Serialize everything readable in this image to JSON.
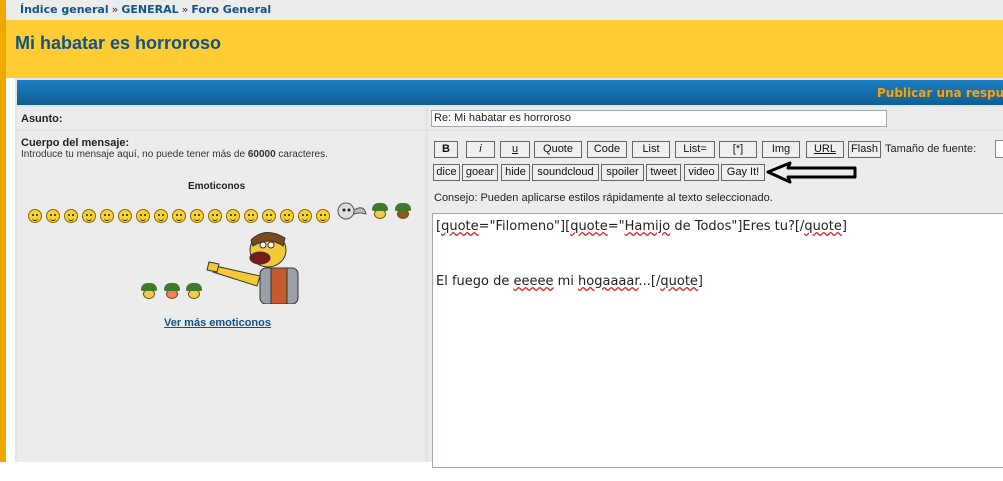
{
  "breadcrumb": {
    "index": "Índice general",
    "sep1": "»",
    "general": "GENERAL",
    "sep2": "»",
    "forum": "Foro General"
  },
  "page": {
    "title": "Mi habatar es horroroso"
  },
  "header": {
    "publish": "Publicar una respues"
  },
  "form": {
    "subject_label": "Asunto:",
    "subject_value": "Re: Mi habatar es horroroso",
    "body_label": "Cuerpo del mensaje:",
    "body_hint_prefix": "Introduce tu mensaje aquí, no puede tener más de ",
    "body_hint_limit": "60000",
    "body_hint_suffix": " caracteres.",
    "font_size_label": "Tamaño de fuente:",
    "tip": "Consejo: Pueden aplicarse estilos rápidamente al texto seleccionado."
  },
  "emoticons": {
    "title": "Emoticonos",
    "more": "Ver más emoticonos",
    "smiley_count": 17
  },
  "toolbar": {
    "row1": [
      "B",
      "i",
      "u",
      "Quote",
      "Code",
      "List",
      "List=",
      "[*]",
      "Img",
      "URL",
      "Flash"
    ],
    "row2": [
      "dice",
      "goear",
      "hide",
      "soundcloud",
      "spoiler",
      "tweet",
      "video",
      "Gay It!"
    ]
  },
  "editor": {
    "line1": {
      "q1": "[",
      "t1": "quote",
      "q2": "=\"Filomeno\"][",
      "t2": "quote",
      "q3": "=\"",
      "t3": "Hamijo",
      "q4": " de Todos\"]Eres tu?[/",
      "t4": "quote",
      "q5": "]"
    },
    "line2": {
      "a": "El fuego de ",
      "b": "eeeee",
      "c": " mi ",
      "d": "hogaaaar",
      "e": "...[/",
      "f": "quote",
      "g": "]"
    }
  },
  "colors": {
    "link": "#105289",
    "titlebar": "#ffcd33",
    "header": "#1d7ec2",
    "publish": "#ffa200"
  }
}
